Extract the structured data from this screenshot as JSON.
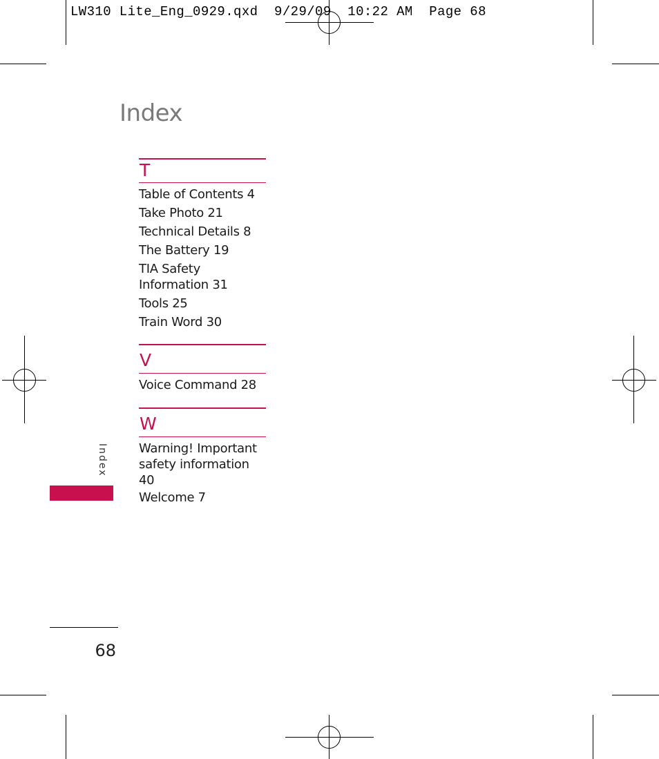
{
  "slug_line": "LW310 Lite_Eng_0929.qxd  9/29/09  10:22 AM  Page 68",
  "page_title": "Index",
  "sections": [
    {
      "letter": "T",
      "entries": [
        "Table of Contents 4",
        "Take Photo 21",
        "Technical Details 8",
        "The Battery 19",
        "TIA Safety Information 31",
        "Tools 25",
        "Train Word 30"
      ]
    },
    {
      "letter": "V",
      "entries": [
        "Voice Command 28"
      ]
    },
    {
      "letter": "W",
      "entries": [
        "Warning! Important safety information 40",
        "Welcome 7"
      ]
    }
  ],
  "side_tab_label": "Index",
  "page_number": "68",
  "colors": {
    "accent": "#c8104e",
    "title_gray": "#7a7a7a"
  }
}
